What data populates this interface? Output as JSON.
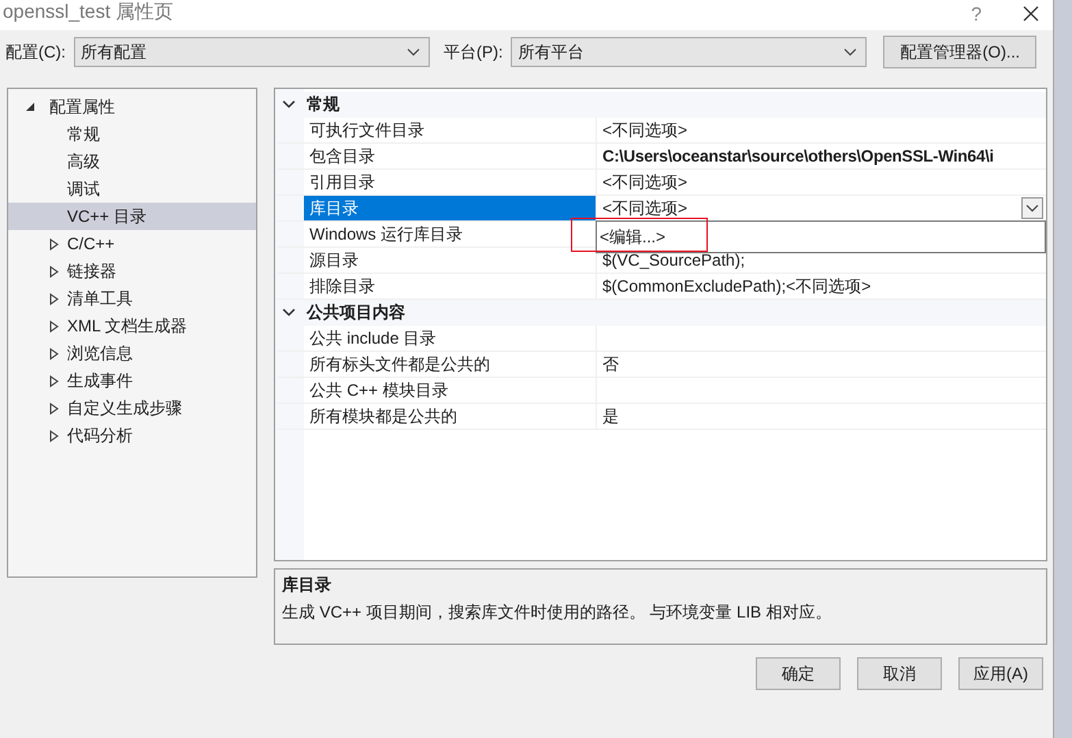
{
  "window": {
    "title": "openssl_test 属性页",
    "help": "?"
  },
  "toolbar": {
    "config_label": "配置(C):",
    "config_value": "所有配置",
    "platform_label": "平台(P):",
    "platform_value": "所有平台",
    "manager_button": "配置管理器(O)..."
  },
  "tree": {
    "label": "配置属性",
    "expanded": true,
    "children": [
      {
        "label": "常规",
        "selected": false,
        "expandable": false
      },
      {
        "label": "高级",
        "selected": false,
        "expandable": false
      },
      {
        "label": "调试",
        "selected": false,
        "expandable": false
      },
      {
        "label": "VC++ 目录",
        "selected": true,
        "expandable": false
      },
      {
        "label": "C/C++",
        "selected": false,
        "expandable": true
      },
      {
        "label": "链接器",
        "selected": false,
        "expandable": true
      },
      {
        "label": "清单工具",
        "selected": false,
        "expandable": true
      },
      {
        "label": "XML 文档生成器",
        "selected": false,
        "expandable": true
      },
      {
        "label": "浏览信息",
        "selected": false,
        "expandable": true
      },
      {
        "label": "生成事件",
        "selected": false,
        "expandable": true
      },
      {
        "label": "自定义生成步骤",
        "selected": false,
        "expandable": true
      },
      {
        "label": "代码分析",
        "selected": false,
        "expandable": true
      }
    ]
  },
  "grid": {
    "sections": [
      {
        "title": "常规",
        "expanded": true,
        "rows": [
          {
            "name": "可执行文件目录",
            "value": "<不同选项>",
            "selected": false
          },
          {
            "name": "包含目录",
            "value": "C:\\Users\\oceanstar\\source\\others\\OpenSSL-Win64\\i",
            "bold": true,
            "selected": false
          },
          {
            "name": "引用目录",
            "value": "<不同选项>",
            "selected": false
          },
          {
            "name": "库目录",
            "value": "<不同选项>",
            "selected": true
          },
          {
            "name": "Windows 运行库目录",
            "selected": false
          },
          {
            "name": "源目录",
            "value": "$(VC_SourcePath);",
            "selected": false
          },
          {
            "name": "排除目录",
            "value": "$(CommonExcludePath);<不同选项>",
            "selected": false
          }
        ]
      },
      {
        "title": "公共项目内容",
        "expanded": true,
        "rows": [
          {
            "name": "公共 include 目录",
            "selected": false
          },
          {
            "name": "所有标头文件都是公共的",
            "value": "否",
            "selected": false
          },
          {
            "name": "公共 C++ 模块目录",
            "selected": false
          },
          {
            "name": "所有模块都是公共的",
            "value": "是",
            "selected": false
          }
        ]
      }
    ],
    "dropdown_items": [
      "<编辑...>"
    ]
  },
  "description": {
    "title": "库目录",
    "text": "生成 VC++ 项目期间，搜索库文件时使用的路径。  与环境变量 LIB 相对应。"
  },
  "buttons": [
    "确定",
    "取消",
    "应用(A)"
  ]
}
